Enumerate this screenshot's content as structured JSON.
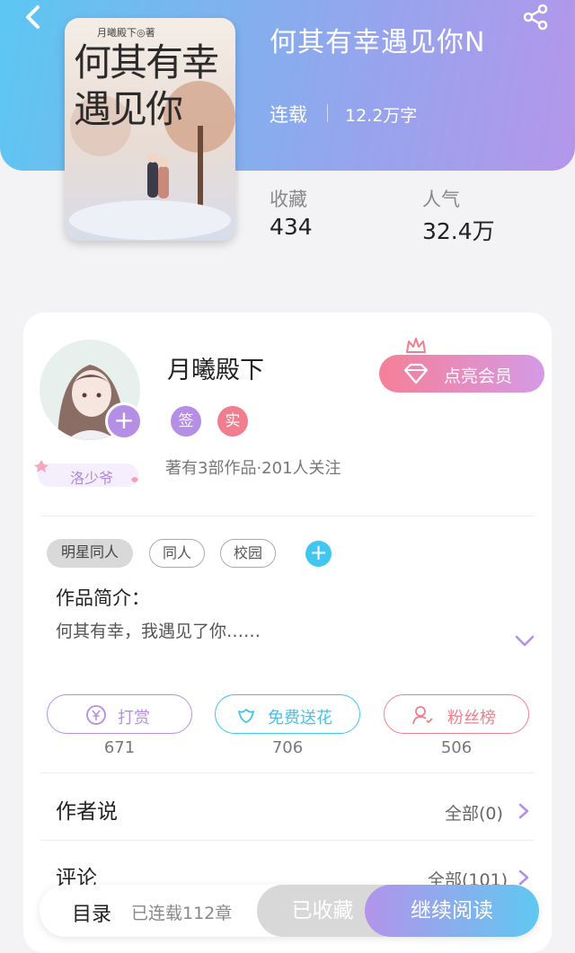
{
  "book": {
    "title": "何其有幸遇见你N",
    "status": "连载",
    "word_count": "12.2万字",
    "cover_title": "何其有幸遇见你",
    "cover_author": "月曦殿下◎著"
  },
  "stats": {
    "collect_label": "收藏",
    "collect_value": "434",
    "popularity_label": "人气",
    "popularity_value": "32.4万"
  },
  "author": {
    "name": "月曦殿下",
    "badge_sign": "签",
    "badge_real": "实",
    "meta": "著有3部作品·201人关注",
    "nickname": "洛少爷",
    "avatar_add": "+"
  },
  "vip": {
    "label": "点亮会员"
  },
  "tags": [
    "明星同人",
    "同人",
    "校园"
  ],
  "tag_add": "+",
  "intro": {
    "title": "作品简介：",
    "text": "何其有幸，我遇见了你……"
  },
  "actions": [
    {
      "label": "打赏",
      "count": "671",
      "color": "#b58ee6"
    },
    {
      "label": "免费送花",
      "count": "706",
      "color": "#3fc4ee"
    },
    {
      "label": "粉丝榜",
      "count": "506",
      "color": "#f07e8e"
    }
  ],
  "author_says": {
    "title": "作者说",
    "link": "全部(0)"
  },
  "comments": {
    "title": "评论",
    "link": "全部(101)"
  },
  "bottom_bar": {
    "catalog": "目录",
    "chapters": "已连载112章",
    "collected": "已收藏",
    "read": "继续阅读"
  },
  "colors": {
    "accent_purple": "#b58ee6",
    "accent_blue": "#3fc4ee",
    "accent_pink": "#f07e8e"
  }
}
